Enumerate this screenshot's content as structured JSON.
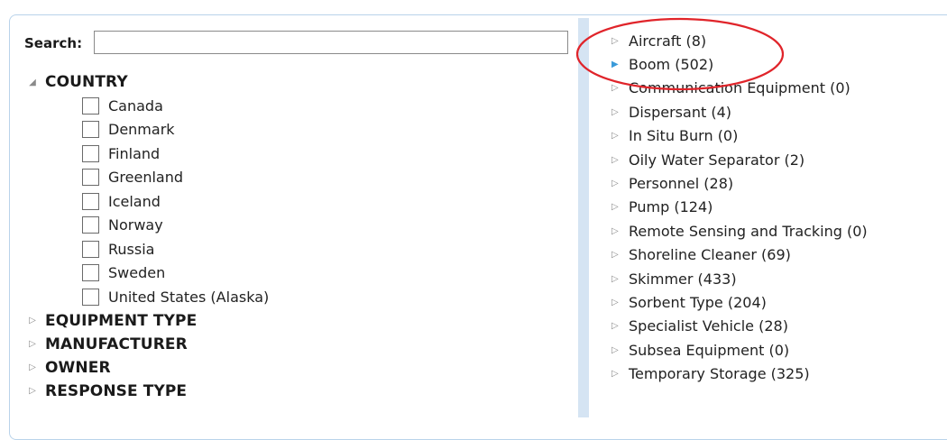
{
  "search": {
    "label": "Search:",
    "value": "",
    "placeholder": ""
  },
  "filters": [
    {
      "name": "COUNTRY",
      "expanded": true,
      "options": [
        "Canada",
        "Denmark",
        "Finland",
        "Greenland",
        "Iceland",
        "Norway",
        "Russia",
        "Sweden",
        "United States (Alaska)"
      ]
    },
    {
      "name": "EQUIPMENT TYPE",
      "expanded": false,
      "options": []
    },
    {
      "name": "MANUFACTURER",
      "expanded": false,
      "options": []
    },
    {
      "name": "OWNER",
      "expanded": false,
      "options": []
    },
    {
      "name": "RESPONSE TYPE",
      "expanded": false,
      "options": []
    }
  ],
  "categories": [
    {
      "label": "Aircraft (8)",
      "hovered": false
    },
    {
      "label": "Boom (502)",
      "hovered": true
    },
    {
      "label": "Communication Equipment (0)",
      "hovered": false
    },
    {
      "label": "Dispersant (4)",
      "hovered": false
    },
    {
      "label": "In Situ Burn (0)",
      "hovered": false
    },
    {
      "label": "Oily Water Separator (2)",
      "hovered": false
    },
    {
      "label": "Personnel (28)",
      "hovered": false
    },
    {
      "label": "Pump (124)",
      "hovered": false
    },
    {
      "label": "Remote Sensing and Tracking (0)",
      "hovered": false
    },
    {
      "label": "Shoreline Cleaner (69)",
      "hovered": false
    },
    {
      "label": "Skimmer (433)",
      "hovered": false
    },
    {
      "label": "Sorbent Type (204)",
      "hovered": false
    },
    {
      "label": "Specialist Vehicle (28)",
      "hovered": false
    },
    {
      "label": "Subsea Equipment (0)",
      "hovered": false
    },
    {
      "label": "Temporary Storage (325)",
      "hovered": false
    }
  ],
  "icons": {
    "expanded": "triangle-down-icon",
    "collapsed": "triangle-right-outline-icon",
    "hovered": "triangle-right-filled-icon"
  },
  "colors": {
    "pane_border": "#b9d3ea",
    "splitter": "#d5e4f3",
    "arrow_gray": "#8a8a8a",
    "arrow_hover": "#3a9ad9",
    "annotation": "#e0242a"
  }
}
